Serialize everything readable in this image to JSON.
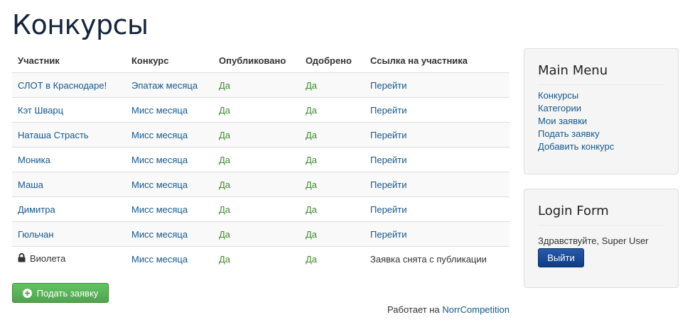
{
  "page": {
    "title": "Конкурсы"
  },
  "table": {
    "headers": [
      "Участник",
      "Конкурс",
      "Опубликовано",
      "Одобрено",
      "Ссылка на участника"
    ],
    "rows": [
      {
        "participant": "СЛОТ в Краснодаре!",
        "contest": "Эпатаж месяца",
        "published": "Да",
        "approved": "Да",
        "link": "Перейти"
      },
      {
        "participant": "Кэт Шварц",
        "contest": "Мисс месяца",
        "published": "Да",
        "approved": "Да",
        "link": "Перейти"
      },
      {
        "participant": "Наташа Страсть",
        "contest": "Мисс месяца",
        "published": "Да",
        "approved": "Да",
        "link": "Перейти"
      },
      {
        "participant": "Моника",
        "contest": "Мисс месяца",
        "published": "Да",
        "approved": "Да",
        "link": "Перейти"
      },
      {
        "participant": "Маша",
        "contest": "Мисс месяца",
        "published": "Да",
        "approved": "Да",
        "link": "Перейти"
      },
      {
        "participant": "Димитра",
        "contest": "Мисс месяца",
        "published": "Да",
        "approved": "Да",
        "link": "Перейти"
      },
      {
        "participant": "Гюльчан",
        "contest": "Мисс месяца",
        "published": "Да",
        "approved": "Да",
        "link": "Перейти"
      },
      {
        "participant": "Виолета",
        "contest": "Мисс месяца",
        "published": "Да",
        "approved": "Да",
        "link": "Заявка снята с публикации",
        "locked": true,
        "locked_icon": "lock-icon"
      }
    ]
  },
  "actions": {
    "submit_label": "Подать заявку",
    "submit_icon": "plus-circle-icon"
  },
  "footer": {
    "prefix": "Работает на",
    "link": "NorrCompetition"
  },
  "main_menu": {
    "title": "Main Menu",
    "items": [
      "Конкурсы",
      "Категории",
      "Мои заявки",
      "Подать заявку",
      "Добавить конкурс"
    ]
  },
  "login_form": {
    "title": "Login Form",
    "greeting": "Здравствуйте, Super User",
    "logout_label": "Выйти"
  },
  "colors": {
    "link": "#15588d",
    "status_green": "#3d8c2f",
    "submit_button": "#51a351",
    "logout_button": "#0c3d86"
  }
}
